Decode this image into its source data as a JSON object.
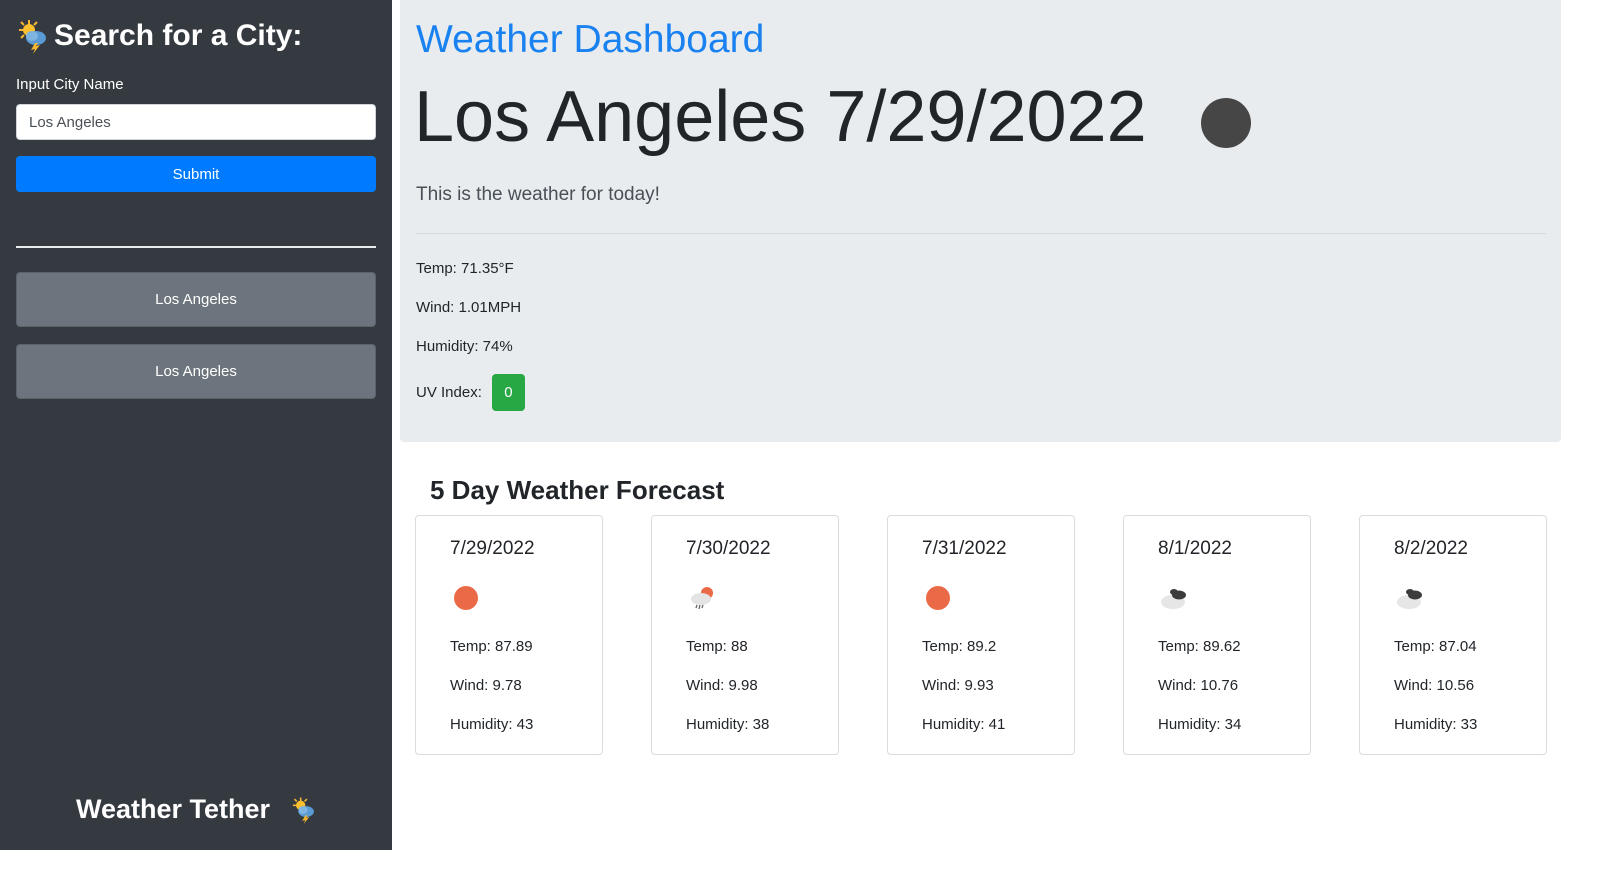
{
  "sidebar": {
    "title": "Search for a City:",
    "input_label": "Input City Name",
    "input_value": "Los Angeles",
    "submit_label": "Submit",
    "history": [
      "Los Angeles",
      "Los Angeles"
    ],
    "footer_title": "Weather Tether"
  },
  "current": {
    "brand": "Weather Dashboard",
    "city_date": "Los Angeles 7/29/2022",
    "lead": "This is the weather for today!",
    "temp": "Temp: 71.35°F",
    "wind": "Wind: 1.01MPH",
    "humidity": "Humidity: 74%",
    "uv_label": "UV Index:",
    "uv_value": "0",
    "uv_color": "#28a745",
    "icon": "dark-circle-icon"
  },
  "forecast": {
    "heading": "5 Day Weather Forecast",
    "days": [
      {
        "date": "7/29/2022",
        "icon": "sun-icon",
        "temp": "Temp: 87.89",
        "wind": "Wind: 9.78",
        "humidity": "Humidity: 43"
      },
      {
        "date": "7/30/2022",
        "icon": "sun-rain-cloud-icon",
        "temp": "Temp: 88",
        "wind": "Wind: 9.98",
        "humidity": "Humidity: 38"
      },
      {
        "date": "7/31/2022",
        "icon": "sun-icon",
        "temp": "Temp: 89.2",
        "wind": "Wind: 9.93",
        "humidity": "Humidity: 41"
      },
      {
        "date": "8/1/2022",
        "icon": "clouds-icon",
        "temp": "Temp: 89.62",
        "wind": "Wind: 10.76",
        "humidity": "Humidity: 34"
      },
      {
        "date": "8/2/2022",
        "icon": "clouds-icon",
        "temp": "Temp: 87.04",
        "wind": "Wind: 10.56",
        "humidity": "Humidity: 33"
      }
    ]
  },
  "colors": {
    "sidebar_bg": "#343a40",
    "primary": "#007bff",
    "brand_text": "#1a82f0",
    "history_bg": "#6c757d",
    "jumbotron_bg": "#e9ecef",
    "sun": "#ea6a47"
  }
}
